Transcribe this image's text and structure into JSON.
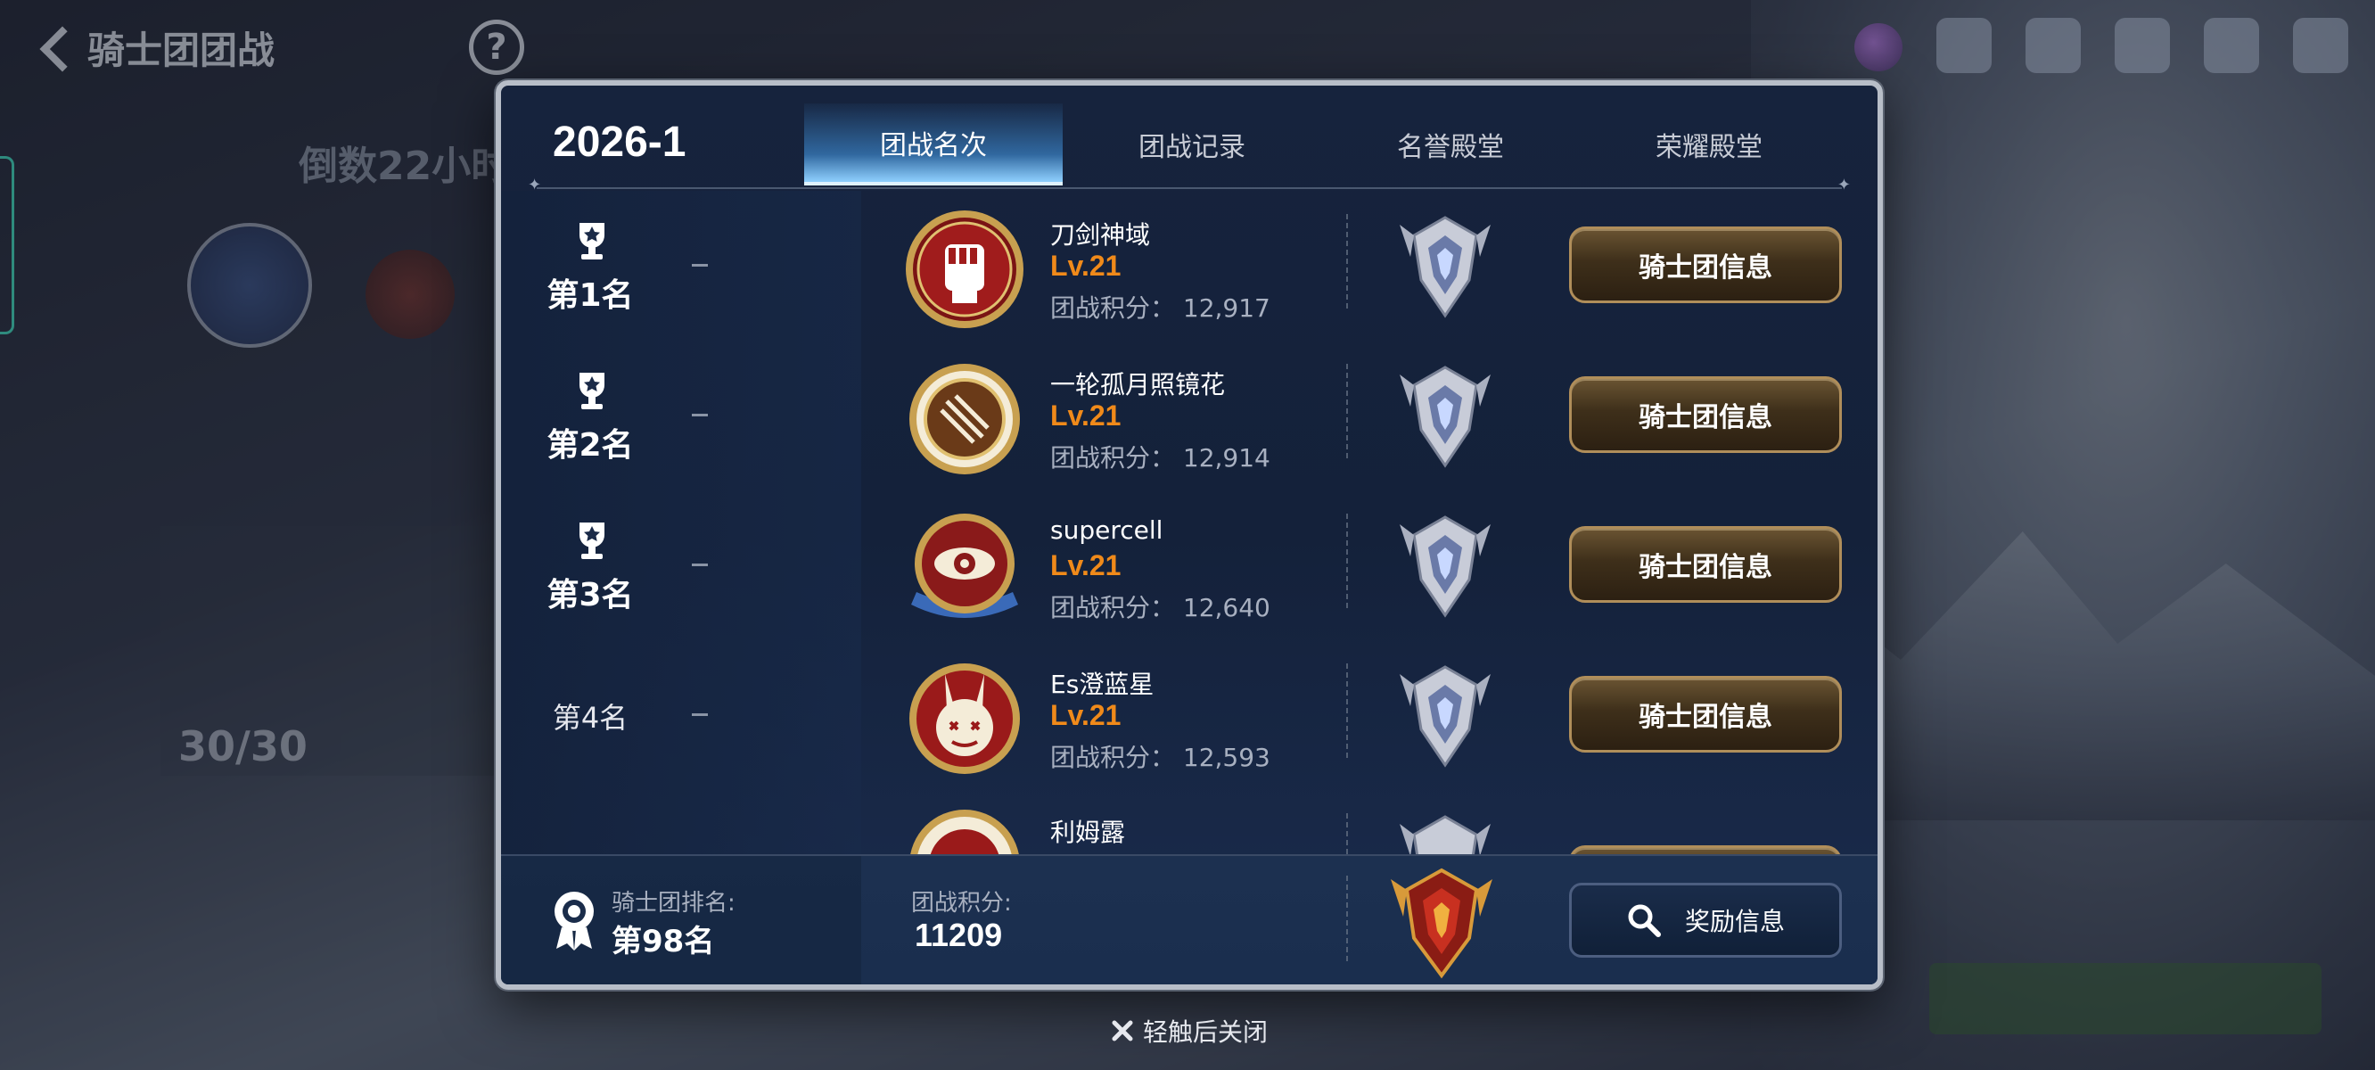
{
  "background": {
    "title": "骑士团团战",
    "countdown": "倒数22小时",
    "score": "30/30"
  },
  "modal": {
    "season": "2026-1",
    "tabs": [
      {
        "label": "团战名次",
        "active": true
      },
      {
        "label": "团战记录",
        "active": false
      },
      {
        "label": "名誉殿堂",
        "active": false
      },
      {
        "label": "荣耀殿堂",
        "active": false
      }
    ],
    "rows": [
      {
        "rank": "第1名",
        "name": "刀剑神域",
        "level": "Lv.21",
        "score": "团战积分：  12,917",
        "button": "骑士团信息"
      },
      {
        "rank": "第2名",
        "name": "一轮孤月照镜花",
        "level": "Lv.21",
        "score": "团战积分：  12,914",
        "button": "骑士团信息"
      },
      {
        "rank": "第3名",
        "name": "supercell",
        "level": "Lv.21",
        "score": "团战积分：  12,640",
        "button": "骑士团信息"
      },
      {
        "rank": "第4名",
        "name": "Es澄蓝星",
        "level": "Lv.21",
        "score": "团战积分：  12,593",
        "button": "骑士团信息"
      },
      {
        "rank": "",
        "name": "利姆露",
        "level": "",
        "score": "",
        "button": ""
      }
    ],
    "footer": {
      "my_rank_label": "骑士团排名:",
      "my_rank_value": "第98名",
      "my_score_label": "团战积分:",
      "my_score_value": "11209",
      "reward_button": "奖励信息"
    }
  },
  "close_hint": "轻触后关闭",
  "colors": {
    "level": "#f08a1a",
    "tab_active": "#8fd0ff",
    "button_gold": "#b08e5a"
  }
}
